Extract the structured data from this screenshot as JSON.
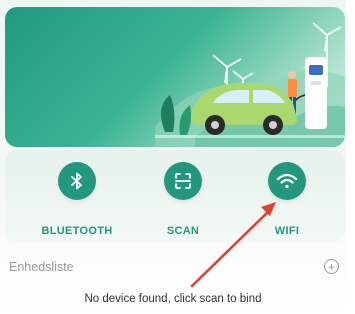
{
  "banner": {
    "illustration": "ev-charging-station-with-car-and-wind-turbines"
  },
  "actions": [
    {
      "label": "BLUETOOTH",
      "icon": "bluetooth-icon"
    },
    {
      "label": "SCAN",
      "icon": "scan-icon"
    },
    {
      "label": "WIFI",
      "icon": "wifi-icon"
    }
  ],
  "device_list": {
    "title": "Enhedsliste",
    "add_icon": "plus-circle-icon",
    "empty_message": "No device found, click scan to bind"
  },
  "annotation": {
    "arrow_color": "#e0422f",
    "points_to": "WIFI"
  },
  "colors": {
    "accent": "#23977e",
    "arrow": "#e0422f"
  }
}
